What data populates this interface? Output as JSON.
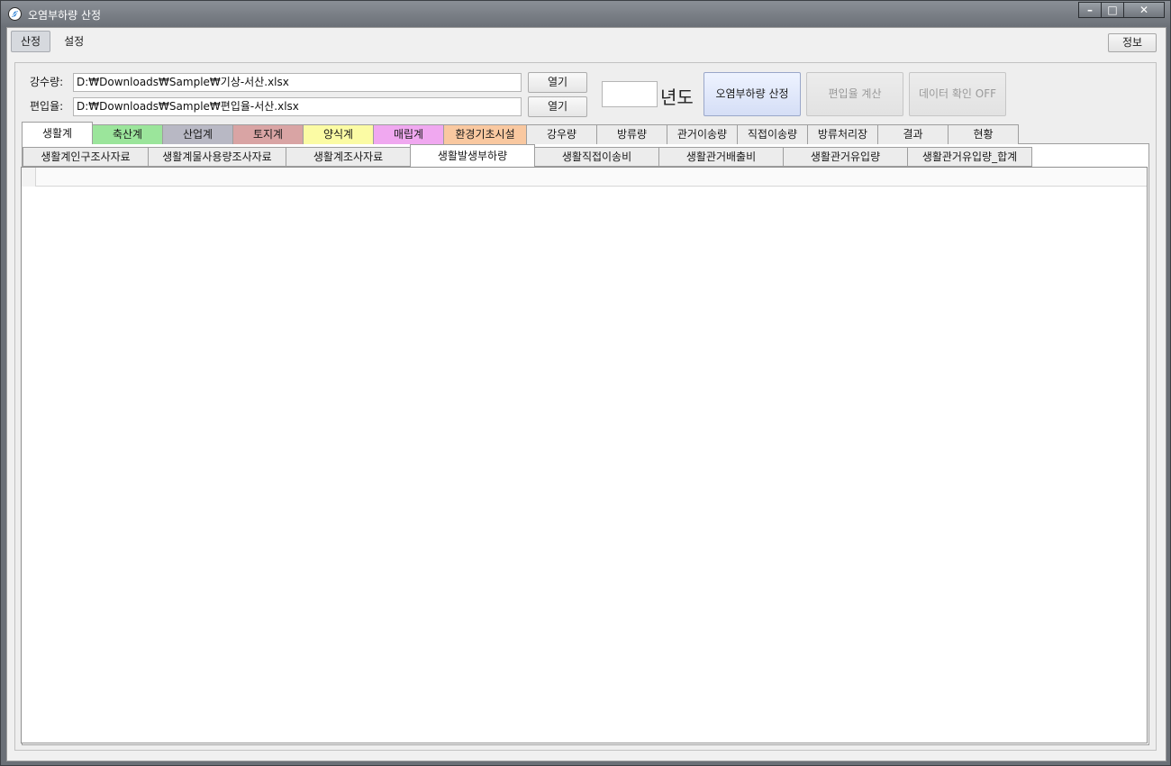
{
  "window": {
    "title": "오염부하량 산정",
    "controls": [
      "minimize-icon",
      "maximize-icon",
      "close-icon"
    ]
  },
  "menu": {
    "tabs": [
      {
        "label": "산정",
        "active": true
      },
      {
        "label": "설정",
        "active": false
      }
    ],
    "info_button": "정보"
  },
  "files": {
    "rainfall_label": "강수량:",
    "rainfall_path": "D:₩Downloads₩Sample₩기상-서산.xlsx",
    "incorporation_label": "편입율:",
    "incorporation_path": "D:₩Downloads₩Sample₩편입율-서산.xlsx",
    "open_label": "열기"
  },
  "year": {
    "value": "",
    "suffix": "년도"
  },
  "actions": {
    "calculate_load": "오염부하량 산정",
    "calculate_incorporation": "편입율 계산",
    "data_check": "데이터 확인 OFF"
  },
  "category_tabs": [
    {
      "label": "생활계",
      "color": "#ffffff",
      "active": true
    },
    {
      "label": "축산계",
      "color": "#9be59b"
    },
    {
      "label": "산업계",
      "color": "#b8b8c4"
    },
    {
      "label": "토지계",
      "color": "#d9a4a4"
    },
    {
      "label": "양식계",
      "color": "#fbfba4"
    },
    {
      "label": "매립계",
      "color": "#f0a8f0"
    },
    {
      "label": "환경기초시설",
      "color": "#f9c8a0"
    },
    {
      "label": "강우량",
      "color": "#ececec"
    },
    {
      "label": "방류량",
      "color": "#ececec"
    },
    {
      "label": "관거이송량",
      "color": "#ececec"
    },
    {
      "label": "직접이송량",
      "color": "#ececec"
    },
    {
      "label": "방류처리장",
      "color": "#ececec"
    },
    {
      "label": "결과",
      "color": "#ececec"
    },
    {
      "label": "현황",
      "color": "#ececec"
    }
  ],
  "sub_tabs": [
    {
      "label": "생활계인구조사자료"
    },
    {
      "label": "생활계물사용량조사자료"
    },
    {
      "label": "생활계조사자료"
    },
    {
      "label": "생활발생부하량",
      "active": true
    },
    {
      "label": "생활직접이송비"
    },
    {
      "label": "생활관거배출비"
    },
    {
      "label": "생활관거유입량"
    },
    {
      "label": "생활관거유입량_합계"
    }
  ]
}
